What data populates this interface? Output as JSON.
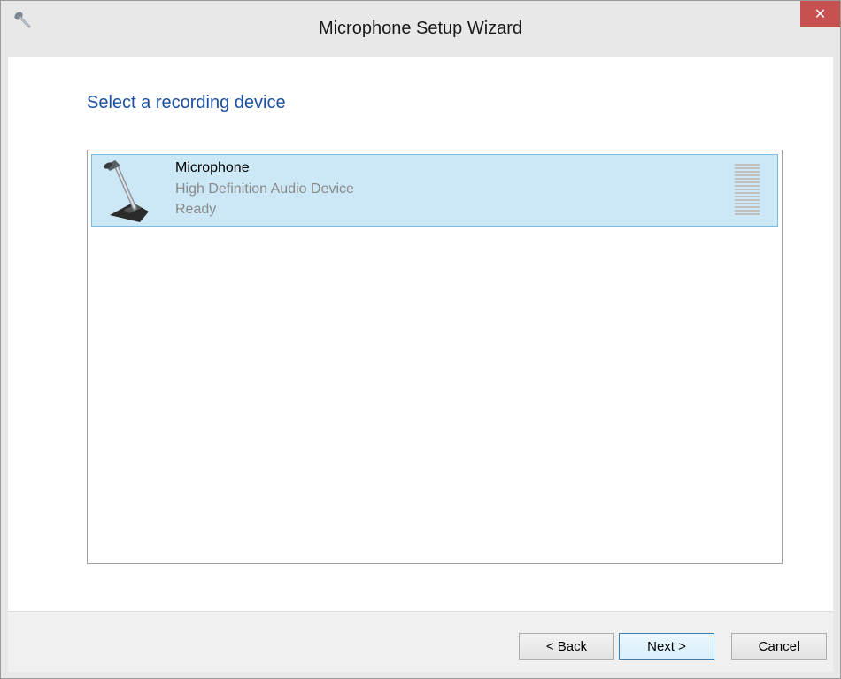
{
  "window": {
    "title": "Microphone Setup Wizard",
    "close_label": "✕"
  },
  "main": {
    "heading": "Select a recording device"
  },
  "devices": [
    {
      "name": "Microphone",
      "description": "High Definition Audio Device",
      "status": "Ready",
      "selected": true
    }
  ],
  "footer": {
    "back_label": "< Back",
    "next_label": "Next >",
    "cancel_label": "Cancel"
  },
  "colors": {
    "heading": "#1e50a2",
    "selection_bg": "#cce8f6",
    "selection_border": "#7cbbe4",
    "close_button": "#c75050"
  },
  "icons": {
    "app": "microphone-icon",
    "device": "desk-microphone-icon",
    "close": "close-icon"
  }
}
